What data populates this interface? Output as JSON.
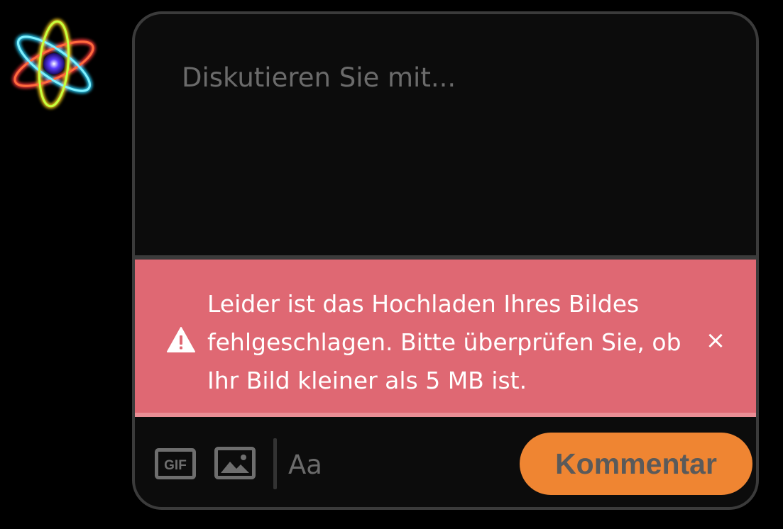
{
  "avatar": {
    "icon": "atom-icon"
  },
  "composer": {
    "placeholder": "Diskutieren Sie mit...",
    "value": ""
  },
  "error": {
    "icon": "warning-icon",
    "lines": [
      "Leider ist das Hochladen Ihres Bildes",
      "fehlgeschlagen. Bitte überprüfen Sie, ob",
      "Ihr Bild kleiner als 5 MB ist."
    ],
    "close_label": "×",
    "background": "#df6873"
  },
  "toolbar": {
    "gif_label": "GIF",
    "image_icon": "image-icon",
    "format_label": "Aa",
    "submit_label": "Kommentar",
    "submit_color": "#ef8532"
  }
}
